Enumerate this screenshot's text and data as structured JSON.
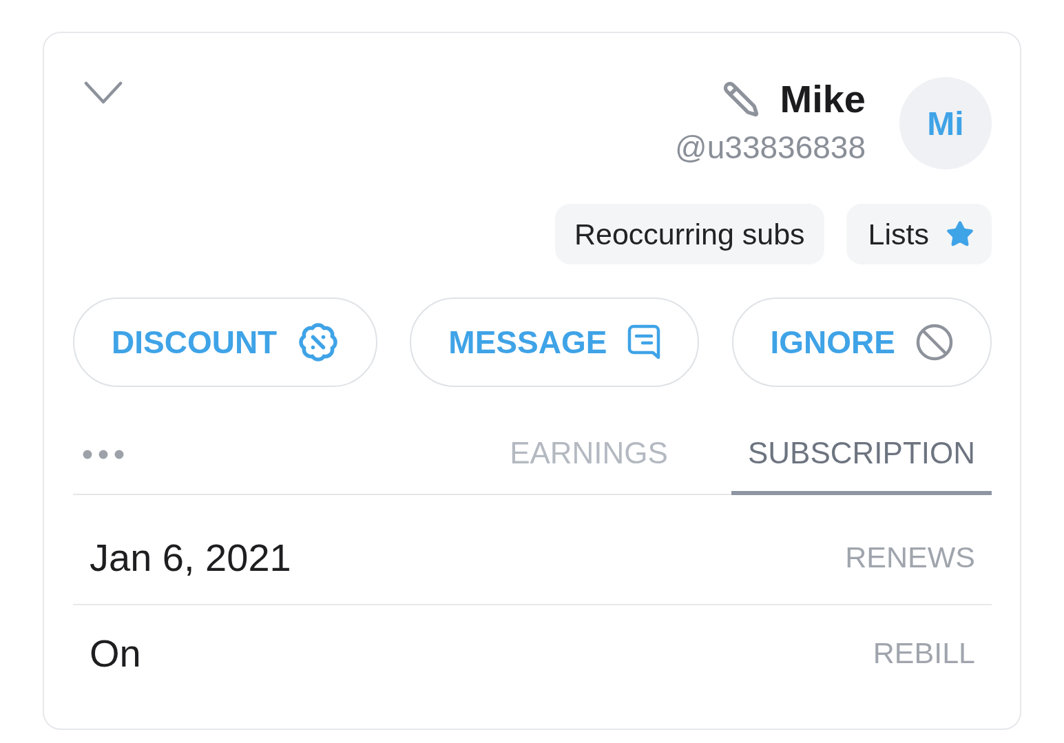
{
  "header": {
    "avatar_initials": "Mi",
    "name": "Mike",
    "username": "@u33836838"
  },
  "chips": [
    {
      "kind": "plain",
      "label": "Reoccurring subs"
    },
    {
      "kind": "starred",
      "label": "Lists"
    }
  ],
  "actions": [
    {
      "kind": "discount",
      "label": "DISCOUNT"
    },
    {
      "kind": "message",
      "label": "MESSAGE"
    },
    {
      "kind": "ignore",
      "label": "IGNORE"
    }
  ],
  "tabs": [
    {
      "label": "EARNINGS",
      "selected": false
    },
    {
      "label": "SUBSCRIPTION",
      "selected": true
    }
  ],
  "details": [
    {
      "label": "RENEWS",
      "value": "Jan 6, 2021"
    },
    {
      "label": "REBILL",
      "value": "On"
    }
  ]
}
